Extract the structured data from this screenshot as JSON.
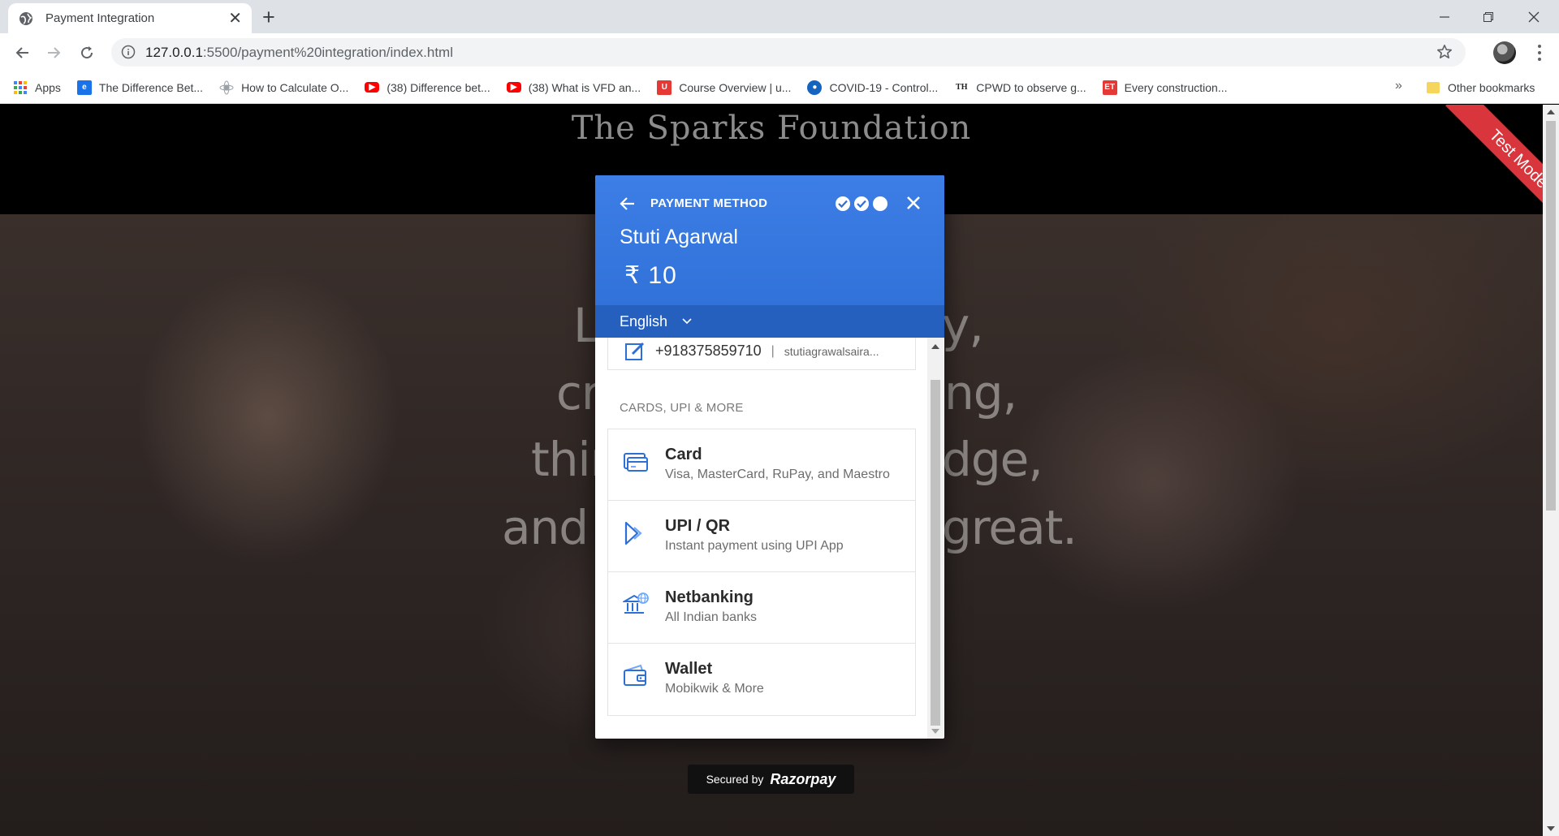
{
  "browser": {
    "tab_title": "Payment Integration",
    "url_host": "127.0.0.1",
    "url_path": ":5500/payment%20integration/index.html",
    "bookmarks": [
      {
        "label": "Apps",
        "icon": "apps-grid-icon",
        "color": "#4285f4"
      },
      {
        "label": "The Difference Bet...",
        "icon": "site-icon",
        "color": "#1a73e8"
      },
      {
        "label": "How to Calculate O...",
        "icon": "site-icon",
        "color": "#9aa0a6"
      },
      {
        "label": "(38) Difference bet...",
        "icon": "youtube-icon",
        "color": "#ff0000"
      },
      {
        "label": "(38) What is VFD an...",
        "icon": "youtube-icon",
        "color": "#ff0000"
      },
      {
        "label": "Course Overview | u...",
        "icon": "site-icon",
        "color": "#e53935"
      },
      {
        "label": "COVID-19 - Control...",
        "icon": "site-icon",
        "color": "#1565c0"
      },
      {
        "label": "CPWD to observe g...",
        "icon": "site-icon",
        "color": "#222222"
      },
      {
        "label": "Every construction...",
        "icon": "site-icon",
        "color": "#e53935"
      }
    ],
    "bookmarks_more": "»",
    "other_bookmarks": "Other bookmarks"
  },
  "site": {
    "title": "The Sparks Foundation",
    "hero_lines": [
      {
        "left": "Lo",
        "right": "y,"
      },
      {
        "left": "cre",
        "right": "ng,"
      },
      {
        "left": "thin",
        "right": "dge,"
      },
      {
        "left": "and k",
        "right": "great."
      }
    ],
    "ribbon": "Test Mode"
  },
  "payment": {
    "header_label": "PAYMENT METHOD",
    "merchant": "Stuti Agarwal",
    "amount": "₹ 10",
    "language": "English",
    "contact_phone": "+918375859710",
    "contact_separator": "|",
    "contact_email": "stutiagrawalsaira...",
    "section_label": "CARDS, UPI & MORE",
    "methods": [
      {
        "name": "Card",
        "desc": "Visa, MasterCard, RuPay, and Maestro",
        "icon": "card-icon"
      },
      {
        "name": "UPI / QR",
        "desc": "Instant payment using UPI App",
        "icon": "upi-icon"
      },
      {
        "name": "Netbanking",
        "desc": "All Indian banks",
        "icon": "bank-icon"
      },
      {
        "name": "Wallet",
        "desc": "Mobikwik & More",
        "icon": "wallet-icon"
      }
    ],
    "secured_text": "Secured by",
    "secured_brand": "Razorpay"
  },
  "colors": {
    "accent": "#3d7ee6",
    "ribbon": "#d8353d"
  }
}
